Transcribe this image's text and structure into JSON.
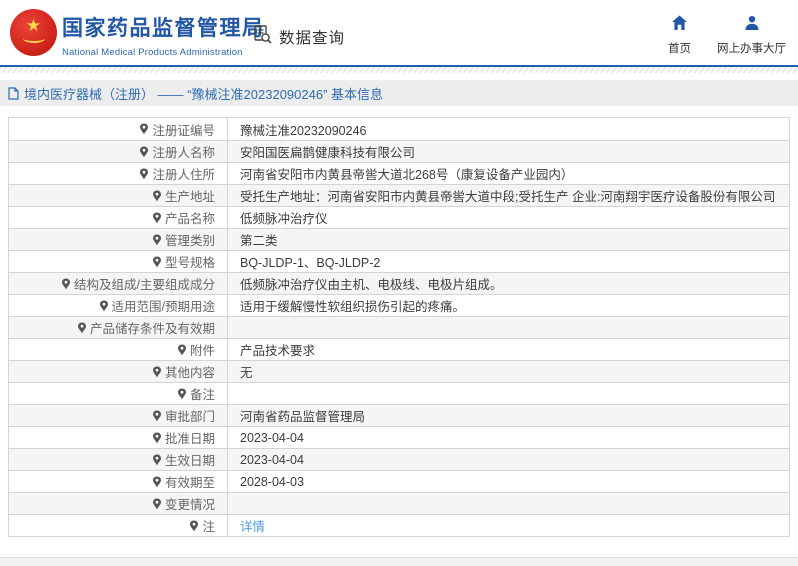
{
  "header": {
    "org_name_cn": "国家药品监督管理局",
    "org_name_en": "National Medical Products Administration",
    "query_label": "数据查询",
    "nav": [
      {
        "label": "首页",
        "icon": "home-icon"
      },
      {
        "label": "网上办事大厅",
        "icon": "person-icon"
      }
    ]
  },
  "breadcrumb": {
    "text": "境内医疗器械（注册） —— “豫械注准20232090246” 基本信息"
  },
  "table": {
    "rows": [
      {
        "label": "注册证编号",
        "value": "豫械注准20232090246"
      },
      {
        "label": "注册人名称",
        "value": "安阳国医扁鹊健康科技有限公司"
      },
      {
        "label": "注册人住所",
        "value": "河南省安阳市内黄县帝喾大道北268号（康复设备产业园内）"
      },
      {
        "label": "生产地址",
        "value": "受托生产地址：河南省安阳市内黄县帝喾大道中段;受托生产 企业:河南翔宇医疗设备股份有限公司"
      },
      {
        "label": "产品名称",
        "value": "低频脉冲治疗仪"
      },
      {
        "label": "管理类别",
        "value": "第二类"
      },
      {
        "label": "型号规格",
        "value": "BQ-JLDP-1、BQ-JLDP-2"
      },
      {
        "label": "结构及组成/主要组成成分",
        "value": "低频脉冲治疗仪由主机、电极线、电极片组成。"
      },
      {
        "label": "适用范围/预期用途",
        "value": "适用于缓解慢性软组织损伤引起的疼痛。"
      },
      {
        "label": "产品储存条件及有效期",
        "value": ""
      },
      {
        "label": "附件",
        "value": "产品技术要求"
      },
      {
        "label": "其他内容",
        "value": "无"
      },
      {
        "label": "备注",
        "value": ""
      },
      {
        "label": "审批部门",
        "value": "河南省药品监督管理局"
      },
      {
        "label": "批准日期",
        "value": "2023-04-04"
      },
      {
        "label": "生效日期",
        "value": "2023-04-04"
      },
      {
        "label": "有效期至",
        "value": "2028-04-03"
      },
      {
        "label": "变更情况",
        "value": ""
      },
      {
        "label": "注",
        "value": "详情",
        "icon": "note-icon",
        "link": true
      }
    ]
  },
  "colors": {
    "accent_blue": "#1a61ae",
    "title_blue": "#2257a5",
    "breadcrumb_blue": "#2e6cb3",
    "link_blue": "#4a9fdd",
    "stripe_gray": "#f5f5f5",
    "border_gray": "#d4d4d4"
  }
}
